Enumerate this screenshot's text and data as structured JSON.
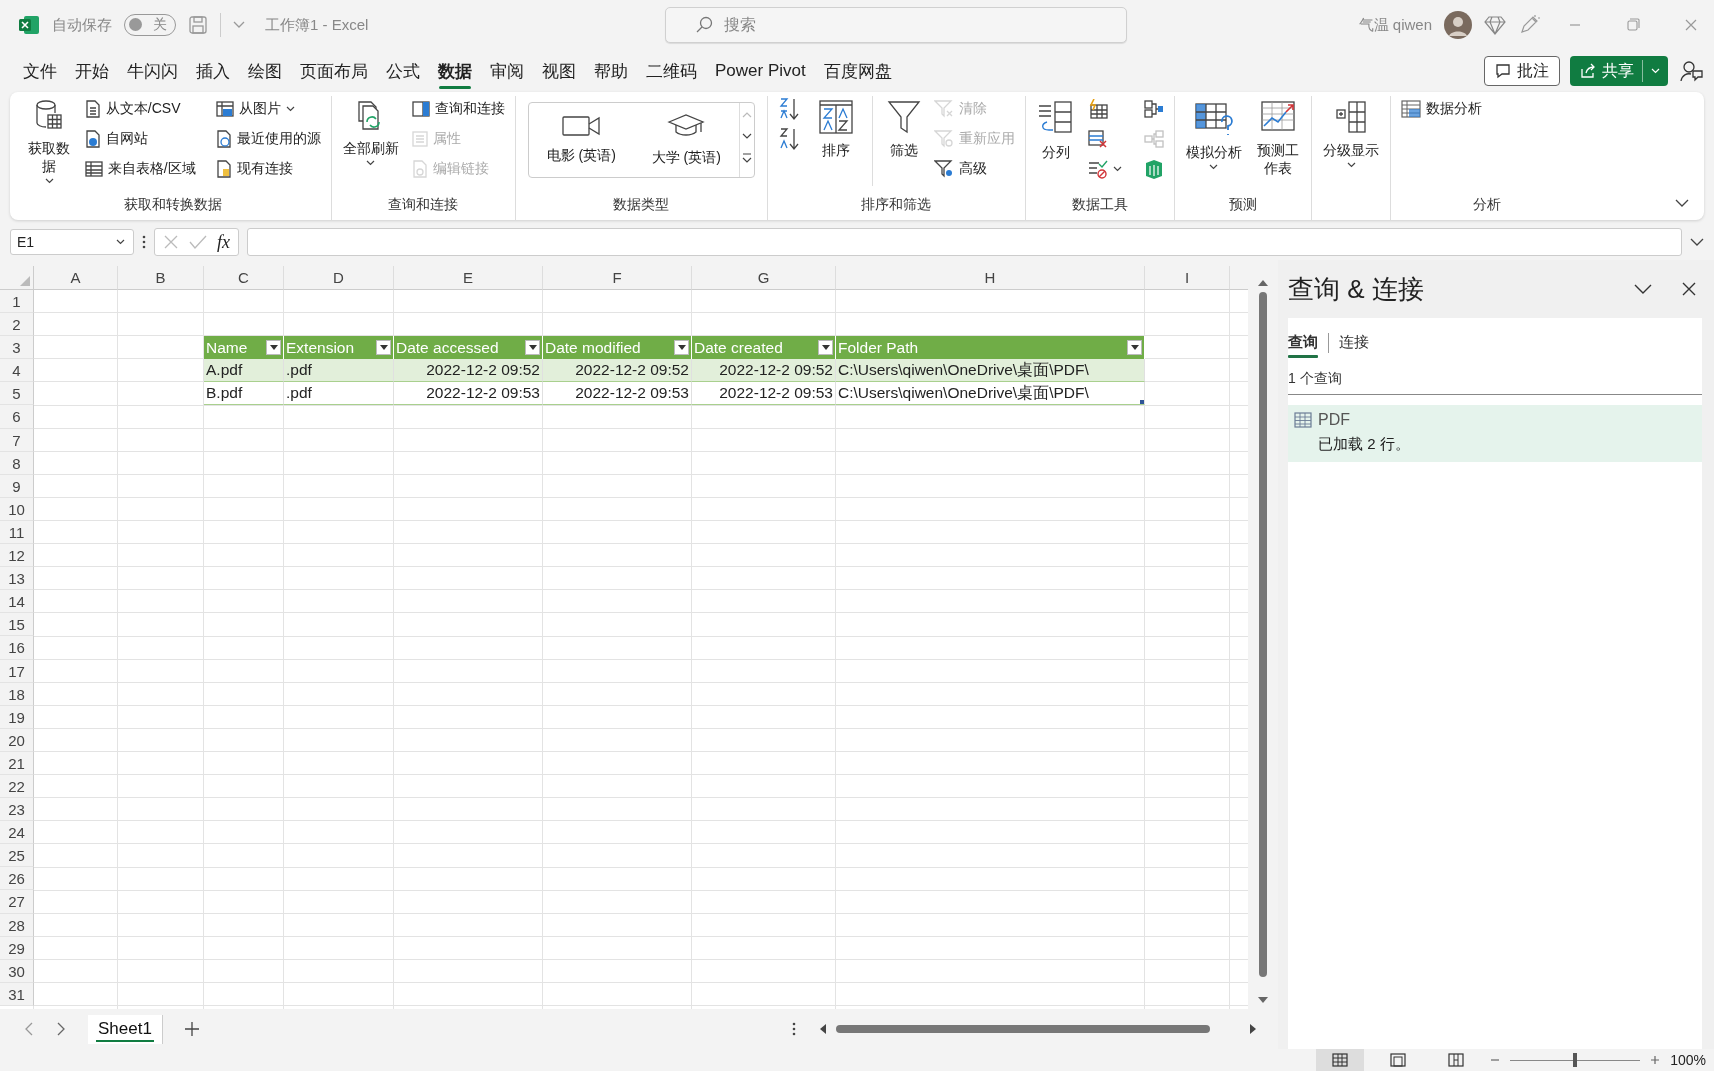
{
  "title_bar": {
    "autosave_label": "自动保存",
    "autosave_toggle": {
      "label": "关",
      "on": false
    },
    "doc_title": "工作簿1 - Excel",
    "search": {
      "placeholder": "搜索"
    },
    "user_name": "气温 qiwen"
  },
  "menu_tabs": [
    {
      "label": "文件",
      "selected": false
    },
    {
      "label": "开始",
      "selected": false
    },
    {
      "label": "牛闪闪",
      "selected": false
    },
    {
      "label": "插入",
      "selected": false
    },
    {
      "label": "绘图",
      "selected": false
    },
    {
      "label": "页面布局",
      "selected": false
    },
    {
      "label": "公式",
      "selected": false
    },
    {
      "label": "数据",
      "selected": true
    },
    {
      "label": "审阅",
      "selected": false
    },
    {
      "label": "视图",
      "selected": false
    },
    {
      "label": "帮助",
      "selected": false
    },
    {
      "label": "二维码",
      "selected": false
    },
    {
      "label": "Power Pivot",
      "selected": false
    },
    {
      "label": "百度网盘",
      "selected": false
    }
  ],
  "menu_buttons": {
    "comments": "批注",
    "share": "共享"
  },
  "ribbon_groups": [
    {
      "label": "获取和转换数据",
      "items": [
        {
          "kind": "large",
          "label": "获取数据",
          "caret": true,
          "disabled": false
        },
        {
          "kind": "small",
          "label": "从文本/CSV",
          "disabled": false
        },
        {
          "kind": "small",
          "label": "自网站",
          "disabled": false
        },
        {
          "kind": "small",
          "label": "来自表格/区域",
          "disabled": false
        },
        {
          "kind": "small",
          "label": "从图片",
          "caret": true,
          "disabled": false
        },
        {
          "kind": "small",
          "label": "最近使用的源",
          "disabled": false
        },
        {
          "kind": "small",
          "label": "现有连接",
          "disabled": false
        }
      ]
    },
    {
      "label": "查询和连接",
      "items": [
        {
          "kind": "large",
          "label": "全部刷新",
          "caret": true,
          "disabled": false
        },
        {
          "kind": "small",
          "label": "查询和连接",
          "disabled": false
        },
        {
          "kind": "small",
          "label": "属性",
          "disabled": true
        },
        {
          "kind": "small",
          "label": "编辑链接",
          "disabled": true
        }
      ]
    },
    {
      "label": "数据类型",
      "items": [
        {
          "kind": "gallery",
          "options": [
            "电影 (英语)",
            "大学 (英语)"
          ]
        }
      ]
    },
    {
      "label": "排序和筛选",
      "items": [
        {
          "kind": "icon",
          "disabled": false
        },
        {
          "kind": "icon",
          "disabled": false
        },
        {
          "kind": "large",
          "label": "排序",
          "disabled": false
        },
        {
          "kind": "large",
          "label": "筛选",
          "disabled": false
        },
        {
          "kind": "small",
          "label": "清除",
          "disabled": true
        },
        {
          "kind": "small",
          "label": "重新应用",
          "disabled": true
        },
        {
          "kind": "small",
          "label": "高级",
          "disabled": false
        }
      ]
    },
    {
      "label": "数据工具",
      "items": [
        {
          "kind": "large",
          "label": "分列",
          "disabled": false
        },
        {
          "kind": "icon",
          "disabled": false
        },
        {
          "kind": "icon",
          "disabled": false
        },
        {
          "kind": "icon",
          "caret": true,
          "disabled": false
        },
        {
          "kind": "icon",
          "disabled": false
        },
        {
          "kind": "icon",
          "disabled": true
        },
        {
          "kind": "icon",
          "disabled": false
        }
      ]
    },
    {
      "label": "预测",
      "items": [
        {
          "kind": "large",
          "label": "模拟分析",
          "caret": true,
          "disabled": false
        },
        {
          "kind": "large",
          "label": "预测工作表",
          "disabled": false
        }
      ]
    },
    {
      "items": [
        {
          "kind": "large",
          "label": "分级显示",
          "caret": true,
          "disabled": false
        }
      ]
    },
    {
      "label": "分析",
      "items": [
        {
          "kind": "small",
          "label": "数据分析",
          "disabled": false
        }
      ]
    }
  ],
  "formula_bar": {
    "name_box": "E1",
    "function_label": "fx"
  },
  "sheet": {
    "columns": [
      "A",
      "B",
      "C",
      "D",
      "E",
      "F",
      "G",
      "H",
      "I"
    ],
    "rows": [
      "1",
      "2",
      "3",
      "4",
      "5",
      "6",
      "7",
      "8",
      "9",
      "10",
      "11",
      "12",
      "13",
      "14",
      "15",
      "16",
      "17",
      "18",
      "19",
      "20",
      "21",
      "22",
      "23",
      "24",
      "25",
      "26",
      "27",
      "28",
      "29",
      "30",
      "31"
    ]
  },
  "table": {
    "columns": [
      {
        "label": "Name",
        "kind": "text"
      },
      {
        "label": "Extension",
        "kind": "text"
      },
      {
        "label": "Date accessed",
        "kind": "date"
      },
      {
        "label": "Date modified",
        "kind": "date"
      },
      {
        "label": "Date created",
        "kind": "date"
      },
      {
        "label": "Folder Path",
        "kind": "text"
      }
    ],
    "rows": [
      [
        "A.pdf",
        ".pdf",
        "2022-12-2 09:52",
        "2022-12-2 09:52",
        "2022-12-2 09:52",
        "C:\\Users\\qiwen\\OneDrive\\桌面\\PDF\\"
      ],
      [
        "B.pdf",
        ".pdf",
        "2022-12-2 09:53",
        "2022-12-2 09:53",
        "2022-12-2 09:53",
        "C:\\Users\\qiwen\\OneDrive\\桌面\\PDF\\"
      ]
    ]
  },
  "sheet_tabs": [
    {
      "label": "Sheet1",
      "selected": true
    }
  ],
  "panel": {
    "title": "查询 & 连接",
    "tabs": [
      {
        "label": "查询",
        "selected": true
      },
      {
        "label": "连接",
        "selected": false
      }
    ],
    "count": "1 个查询",
    "queries": [
      {
        "name": "PDF",
        "status": "已加载 2 行。",
        "selected": true
      }
    ]
  },
  "status_bar": {
    "views": [
      {
        "selected": true
      },
      {
        "selected": false
      },
      {
        "selected": false
      }
    ],
    "zoom": {
      "level": 0.5
    },
    "zoom_label": "100%"
  }
}
